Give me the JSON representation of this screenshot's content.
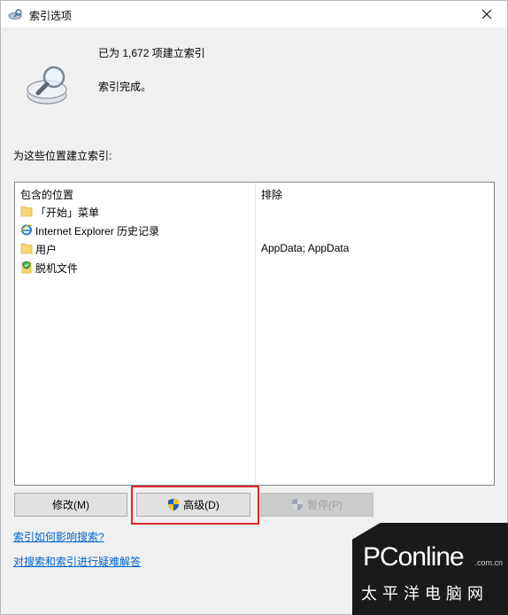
{
  "window": {
    "title": "索引选项"
  },
  "status": {
    "count_text": "已为 1,672 项建立索引",
    "state_text": "索引完成。"
  },
  "section": {
    "label": "为这些位置建立索引:"
  },
  "table": {
    "headers": [
      "包含的位置",
      "排除"
    ],
    "rows": [
      {
        "icon": "folder-icon",
        "location": "「开始」菜单",
        "exclude": ""
      },
      {
        "icon": "internet-explorer-icon",
        "location": "Internet Explorer 历史记录",
        "exclude": ""
      },
      {
        "icon": "folder-icon",
        "location": "用户",
        "exclude": "AppData; AppData"
      },
      {
        "icon": "offline-files-icon",
        "location": "脱机文件",
        "exclude": ""
      }
    ]
  },
  "buttons": {
    "modify": "修改(M)",
    "advanced": "高级(D)",
    "pause": "暂停(P)"
  },
  "links": {
    "how_affects": "索引如何影响搜索?",
    "troubleshoot": "对搜索和索引进行疑难解答"
  },
  "watermark": {
    "brand": "PConline",
    "suffix": ".com.cn",
    "sub": "太平洋电脑网"
  },
  "colors": {
    "highlight": "#e0272a",
    "link": "#0066cc",
    "folder": "#f7d774"
  }
}
